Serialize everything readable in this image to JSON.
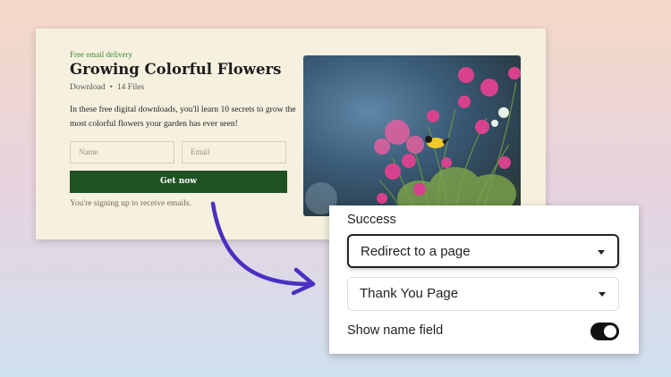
{
  "card": {
    "eyebrow": "Free email delivery",
    "title": "Growing Colorful Flowers",
    "meta_type": "Download",
    "meta_separator": "•",
    "meta_count": "14 Files",
    "description": "In these free digital downloads, you'll learn 10 secrets to grow the most colorful flowers your garden has ever seen!",
    "name_placeholder": "Name",
    "email_placeholder": "Email",
    "button_label": "Get now",
    "note": "You're signing up to receive emails."
  },
  "panel": {
    "success_label": "Success",
    "redirect_value": "Redirect to a page",
    "page_value": "Thank You Page",
    "toggle_label": "Show name field",
    "toggle_on": true
  },
  "colors": {
    "accent_green": "#1e5222",
    "eyebrow_green": "#3f8a37",
    "arrow_purple": "#4b2fc0"
  },
  "icons": [
    "chevron-down-icon",
    "toggle-switch-icon",
    "curved-arrow-icon"
  ]
}
